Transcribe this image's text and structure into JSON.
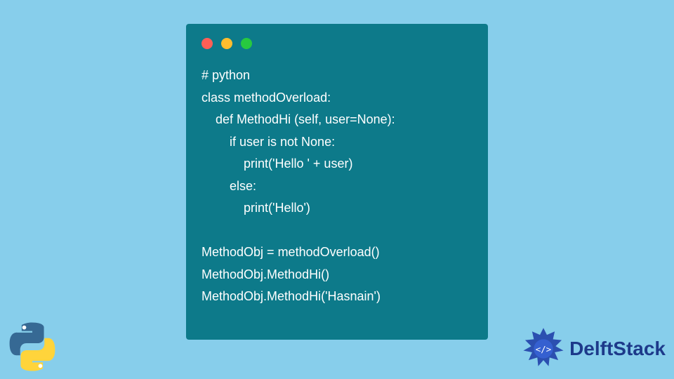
{
  "code": {
    "lines": [
      "# python",
      "class methodOverload:",
      "    def MethodHi (self, user=None):",
      "        if user is not None:",
      "            print('Hello ' + user)",
      "        else:",
      "            print('Hello')",
      "",
      "MethodObj = methodOverload()",
      "MethodObj.MethodHi()",
      "MethodObj.MethodHi('Hasnain')"
    ]
  },
  "branding": {
    "name": "DelftStack"
  }
}
